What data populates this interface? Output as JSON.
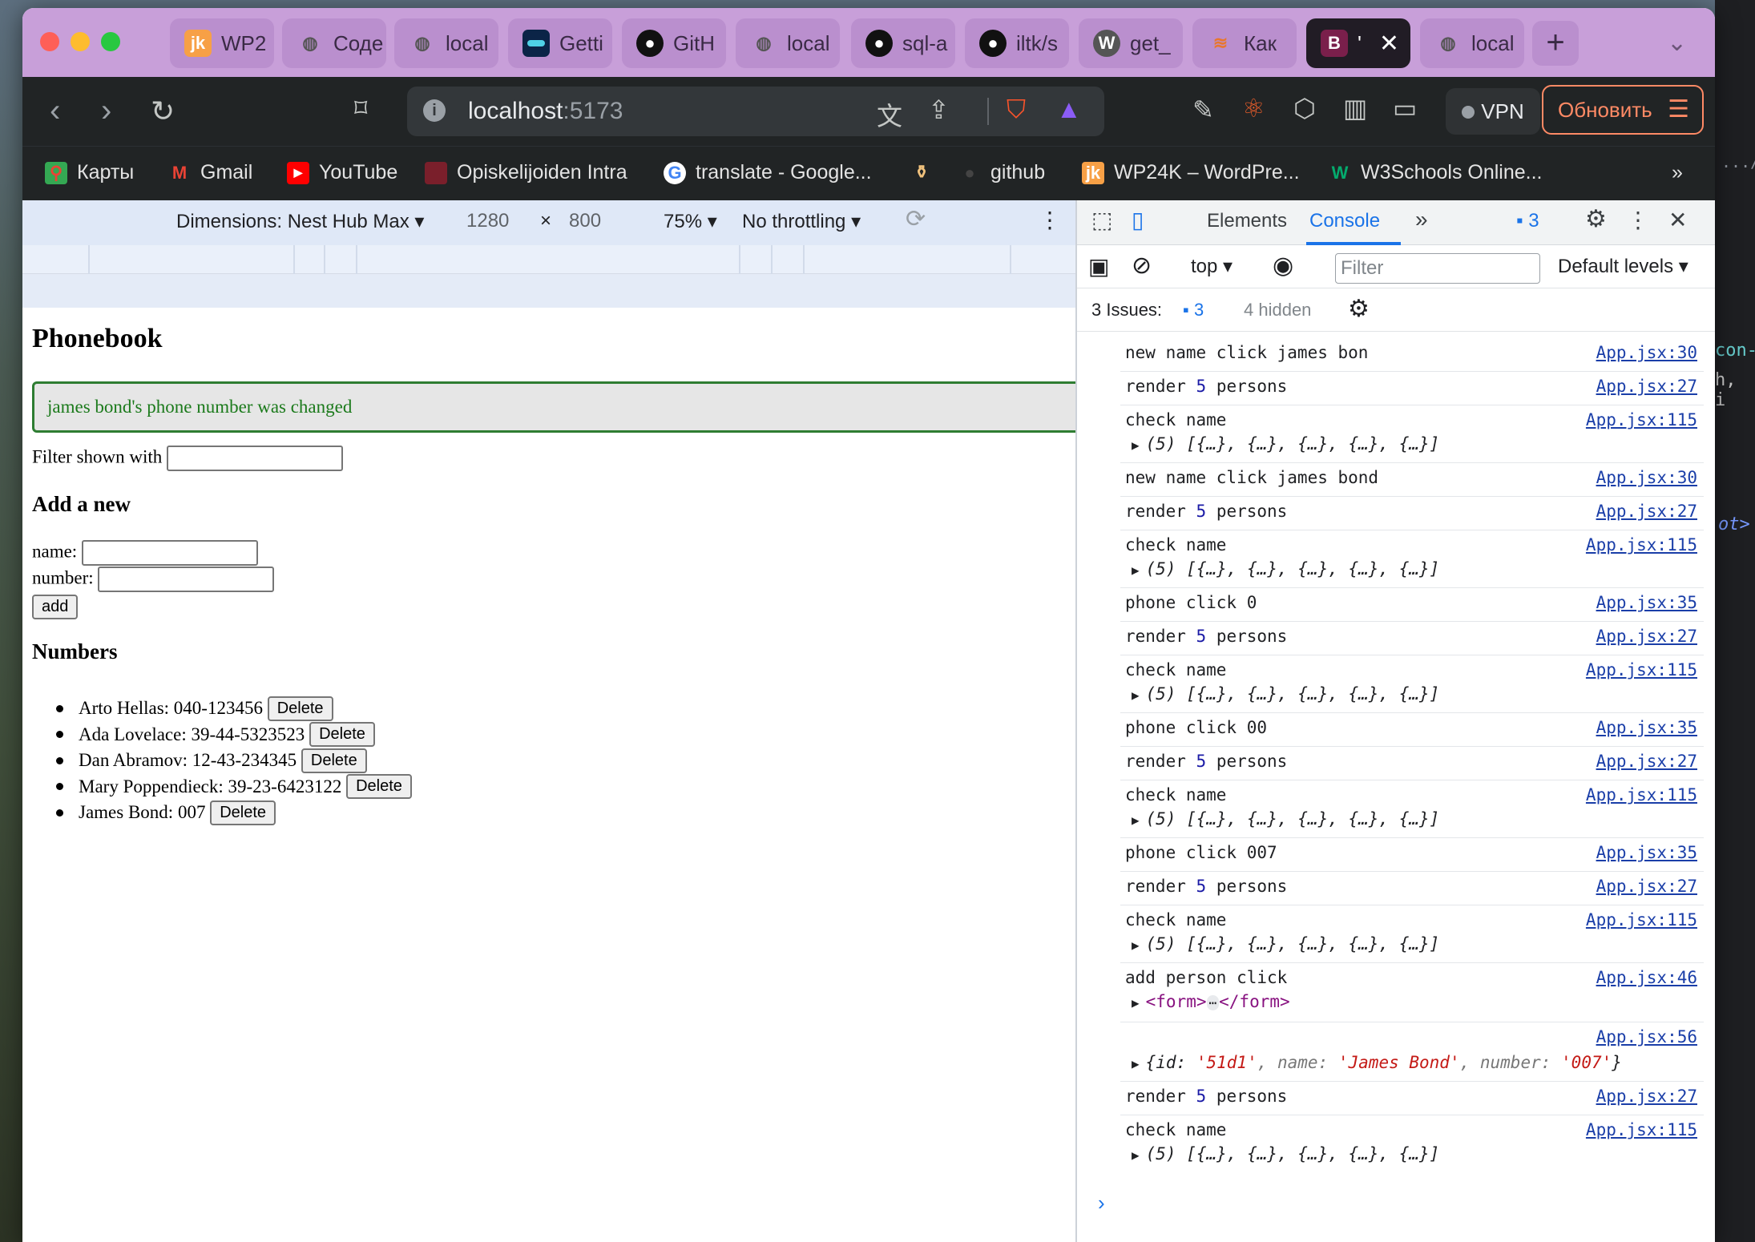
{
  "browser": {
    "tabs": [
      {
        "label": "WP2",
        "icon": "jk-icon"
      },
      {
        "label": "Соде",
        "icon": "globe-icon"
      },
      {
        "label": "local",
        "icon": "globe-icon"
      },
      {
        "label": "Getti",
        "icon": "app-icon"
      },
      {
        "label": "GitH",
        "icon": "github-icon"
      },
      {
        "label": "local",
        "icon": "globe-icon"
      },
      {
        "label": "sql-a",
        "icon": "github-icon"
      },
      {
        "label": "iltk/s",
        "icon": "github-icon"
      },
      {
        "label": "get_",
        "icon": "wordpress-icon"
      },
      {
        "label": "Как",
        "icon": "stack-icon"
      },
      {
        "label": "'",
        "icon": "b-icon",
        "active": true
      },
      {
        "label": "local",
        "icon": "globe-icon"
      }
    ],
    "url_host": "localhost",
    "url_port": ":5173",
    "vpn_label": "VPN",
    "update_label": "Обновить",
    "bookmarks": [
      {
        "label": "Карты",
        "icon": "maps-icon"
      },
      {
        "label": "Gmail",
        "icon": "gmail-icon"
      },
      {
        "label": "YouTube",
        "icon": "youtube-icon"
      },
      {
        "label": "Opiskelijoiden Intra",
        "icon": "intra-icon"
      },
      {
        "label": "translate - Google...",
        "icon": "google-icon"
      },
      {
        "label": "",
        "icon": "bottle-icon"
      },
      {
        "label": "github",
        "icon": "github-icon"
      },
      {
        "label": "WP24K – WordPre...",
        "icon": "jk-icon"
      },
      {
        "label": "W3Schools Online...",
        "icon": "w3schools-icon"
      }
    ],
    "bookmarks_more": "»"
  },
  "device_toolbar": {
    "dimensions_label": "Dimensions: Nest Hub Max ▾",
    "width": "1280",
    "times": "×",
    "height": "800",
    "zoom": "75% ▾",
    "throttling": "No throttling ▾"
  },
  "page": {
    "title": "Phonebook",
    "notification": "james bond's phone number was changed",
    "filter_label": "Filter shown with",
    "add_heading": "Add a new",
    "name_label": "name:",
    "number_label": "number:",
    "add_button": "add",
    "numbers_heading": "Numbers",
    "delete_label": "Delete",
    "persons": [
      {
        "text": "Arto Hellas: 040-123456"
      },
      {
        "text": "Ada Lovelace: 39-44-5323523"
      },
      {
        "text": "Dan Abramov: 12-43-234345"
      },
      {
        "text": "Mary Poppendieck: 39-23-6423122"
      },
      {
        "text": "James Bond: 007"
      }
    ]
  },
  "devtools": {
    "tab_elements": "Elements",
    "tab_console": "Console",
    "issues_badge": "3",
    "context": "top ▾",
    "filter_placeholder": "Filter",
    "levels": "Default levels ▾",
    "issues_label": "3 Issues:",
    "issues_count": "3",
    "hidden_label": "4 hidden",
    "array_preview": "(5) [{…}, {…}, {…}, {…}, {…}]",
    "form_open": "<form>",
    "form_ellipsis": "⋯",
    "form_close": "</form>",
    "obj_open": "{id: ",
    "obj_id": "'51d1'",
    "obj_name_key": ", name: ",
    "obj_name": "'James Bond'",
    "obj_num_key": ", number: ",
    "obj_num": "'007'",
    "obj_close": "}",
    "logs": {
      "l1": {
        "msg": "new name click james bon",
        "src": "App.jsx:30"
      },
      "l2": {
        "pre": "render ",
        "num": "5",
        "post": " persons",
        "src": "App.jsx:27"
      },
      "l3": {
        "msg": "check name",
        "src": "App.jsx:115"
      },
      "l4": {
        "msg": "new name click james bond",
        "src": "App.jsx:30"
      },
      "l5": {
        "pre": "render ",
        "num": "5",
        "post": " persons",
        "src": "App.jsx:27"
      },
      "l6": {
        "msg": "check name",
        "src": "App.jsx:115"
      },
      "l7": {
        "msg": "phone click 0",
        "src": "App.jsx:35"
      },
      "l8": {
        "pre": "render ",
        "num": "5",
        "post": " persons",
        "src": "App.jsx:27"
      },
      "l9": {
        "msg": "check name",
        "src": "App.jsx:115"
      },
      "l10": {
        "msg": "phone click 00",
        "src": "App.jsx:35"
      },
      "l11": {
        "pre": "render ",
        "num": "5",
        "post": " persons",
        "src": "App.jsx:27"
      },
      "l12": {
        "msg": "check name",
        "src": "App.jsx:115"
      },
      "l13": {
        "msg": "phone click 007",
        "src": "App.jsx:35"
      },
      "l14": {
        "pre": "render ",
        "num": "5",
        "post": " persons",
        "src": "App.jsx:27"
      },
      "l15": {
        "msg": "check name",
        "src": "App.jsx:115"
      },
      "l16": {
        "msg": "add person click",
        "src": "App.jsx:46"
      },
      "l17": {
        "src": "App.jsx:56"
      },
      "l18": {
        "pre": "render ",
        "num": "5",
        "post": " persons",
        "src": "App.jsx:27"
      },
      "l19": {
        "msg": "check name",
        "src": "App.jsx:115"
      }
    },
    "prompt": "›"
  },
  "colors": {
    "accent": "#1a73e8",
    "tabbar": "#c89fd9",
    "success": "#2e7d32"
  }
}
